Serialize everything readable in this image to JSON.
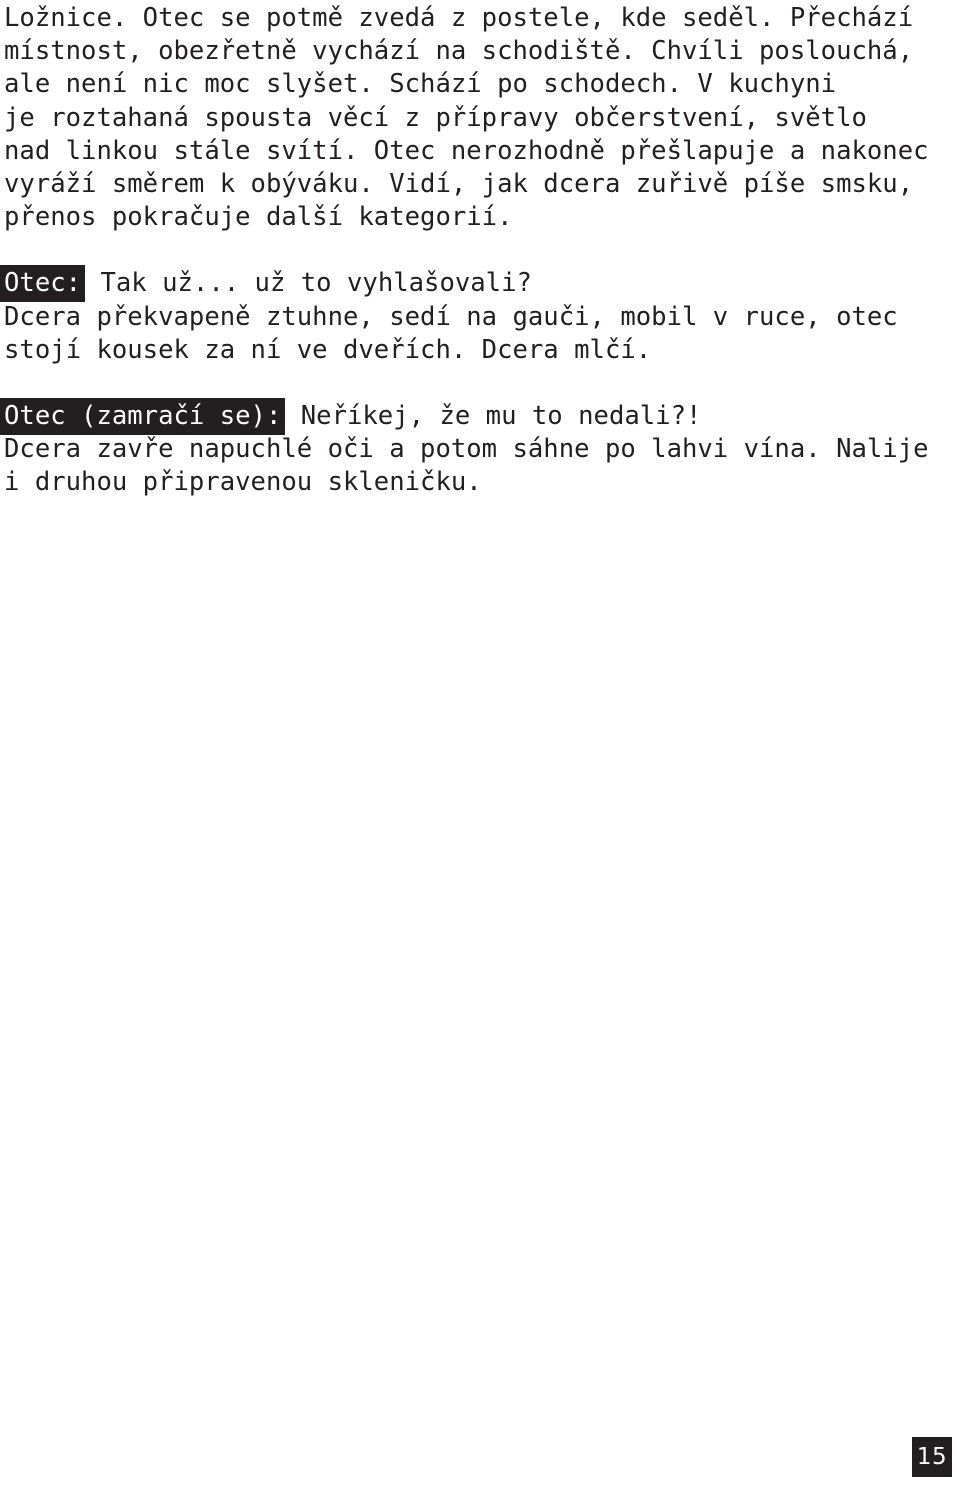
{
  "document": {
    "language": "cs",
    "page_number": "15",
    "text_color": "#231f20",
    "background_color": "#ffffff",
    "highlight_background": "#231f20",
    "highlight_text_color": "#ffffff"
  },
  "blocks": {
    "narration_1": "Ložnice. Otec se potmě zvedá z postele, kde seděl. Přechází\nmístnost, obezřetně vychází na schodiště. Chvíli poslouchá,\nale není nic moc slyšet. Schází po schodech. V kuchyni\nje roztahaná spousta věcí z přípravy občerstvení, světlo\nnad linkou stále svítí. Otec nerozhodně přešlapuje a nakonec\nvyráží směrem k obýváku. Vidí, jak dcera zuřivě píše smsku,\npřenos pokračuje další kategorií.",
    "dialogue_1_speaker": "Otec:",
    "dialogue_1_speech": " Tak už... už to vyhlašovali?",
    "narration_2": "Dcera překvapeně ztuhne, sedí na gauči, mobil v ruce, otec\nstojí kousek za ní ve dveřích. Dcera mlčí.",
    "dialogue_2_speaker": "Otec (zamračí se):",
    "dialogue_2_speech": " Neříkej, že mu to nedali?!",
    "narration_3": "Dcera zavře napuchlé oči a potom sáhne po lahvi vína. Nalije\ni druhou připravenou skleničku."
  }
}
